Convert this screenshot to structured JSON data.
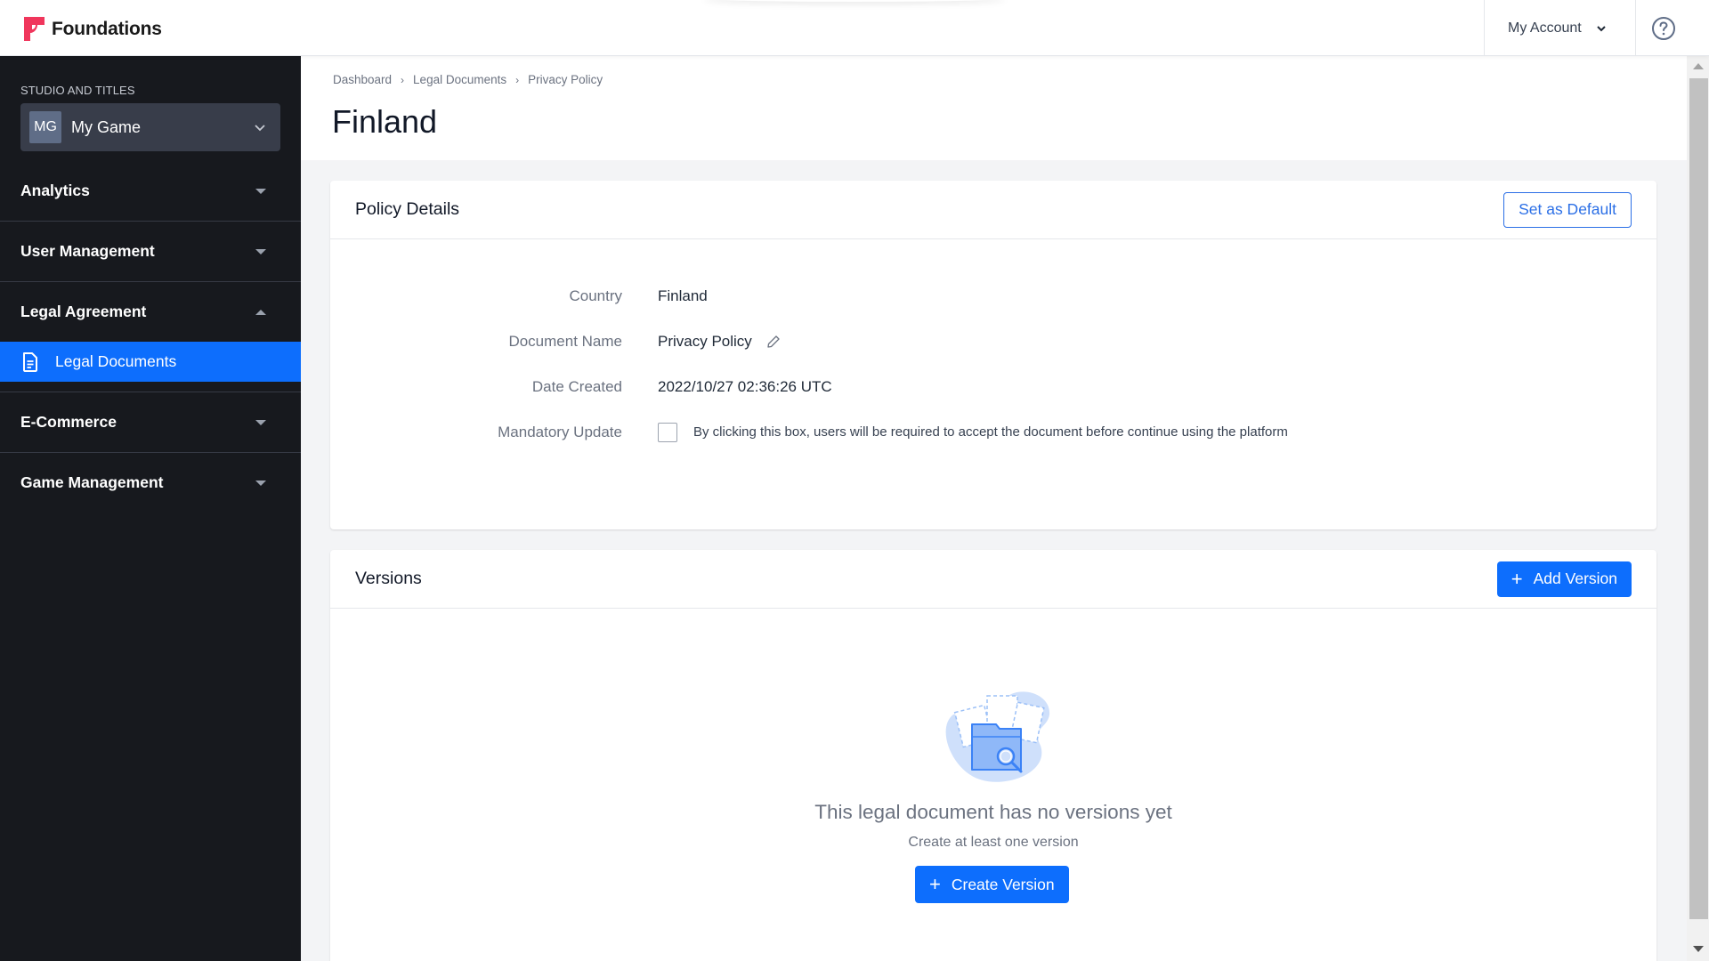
{
  "header": {
    "brand": "Foundations",
    "account_label": "My Account",
    "help_icon": "question-circle-icon"
  },
  "sidebar": {
    "section_label": "STUDIO AND TITLES",
    "studio": {
      "initials": "MG",
      "name": "My Game"
    },
    "groups": [
      {
        "label": "Analytics",
        "expanded": false
      },
      {
        "label": "User Management",
        "expanded": false
      },
      {
        "label": "Legal Agreement",
        "expanded": true,
        "children": [
          {
            "label": "Legal Documents",
            "icon": "document-icon",
            "active": true
          }
        ]
      },
      {
        "label": "E-Commerce",
        "expanded": false
      },
      {
        "label": "Game Management",
        "expanded": false
      }
    ]
  },
  "breadcrumb": [
    "Dashboard",
    "Legal Documents",
    "Privacy Policy"
  ],
  "page_title": "Finland",
  "policy_details": {
    "title": "Policy Details",
    "set_default_label": "Set as Default",
    "fields": {
      "country": {
        "label": "Country",
        "value": "Finland"
      },
      "document_name": {
        "label": "Document Name",
        "value": "Privacy Policy"
      },
      "date_created": {
        "label": "Date Created",
        "value": "2022/10/27 02:36:26 UTC"
      },
      "mandatory_update": {
        "label": "Mandatory Update",
        "checked": false,
        "description": "By clicking this box, users will be required to accept the document before continue using the platform"
      }
    }
  },
  "versions": {
    "title": "Versions",
    "add_label": "Add Version",
    "empty_title": "This legal document has no versions yet",
    "empty_subtitle": "Create at least one version",
    "create_label": "Create Version"
  },
  "colors": {
    "brand": "#f0365c",
    "primary": "#0d6efd",
    "sidebar_bg": "#17191e"
  }
}
